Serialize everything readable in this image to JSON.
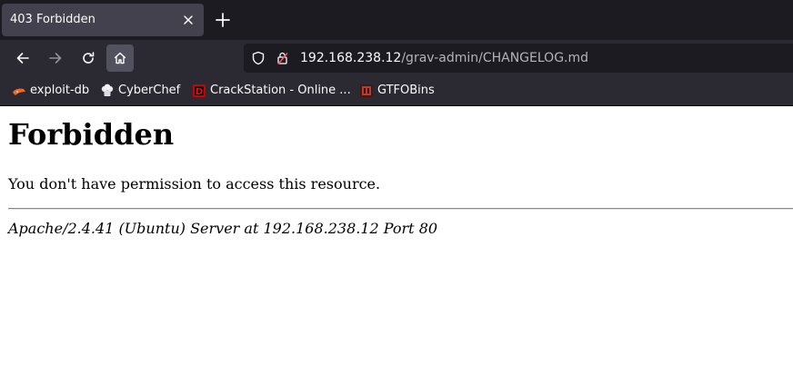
{
  "tab": {
    "title": "403 Forbidden",
    "close_icon": "close-icon",
    "new_tab_icon": "plus-icon"
  },
  "nav": {
    "back_icon": "arrow-left-icon",
    "forward_icon": "arrow-right-icon",
    "reload_icon": "reload-icon",
    "home_icon": "home-icon"
  },
  "urlbar": {
    "host": "192.168.238.12",
    "path": "/grav-admin/CHANGELOG.md",
    "shield_icon": "shield-icon",
    "lock_icon": "lock-warning-icon"
  },
  "bookmarks": [
    {
      "label": "exploit-db",
      "icon": "exploit-db-icon"
    },
    {
      "label": "CyberChef",
      "icon": "cyberchef-icon"
    },
    {
      "label": "CrackStation - Online ...",
      "icon": "crackstation-icon"
    },
    {
      "label": "GTFOBins",
      "icon": "gtfobins-icon"
    }
  ],
  "page": {
    "heading": "Forbidden",
    "message": "You don't have permission to access this resource.",
    "server_signature": "Apache/2.4.41 (Ubuntu) Server at 192.168.238.12 Port 80"
  },
  "colors": {
    "tabstrip_bg": "#1c1b22",
    "toolbar_bg": "#2b2a33",
    "active_tab_bg": "#42414d",
    "urlbar_bg": "#1c1b22",
    "page_bg": "#ffffff"
  }
}
